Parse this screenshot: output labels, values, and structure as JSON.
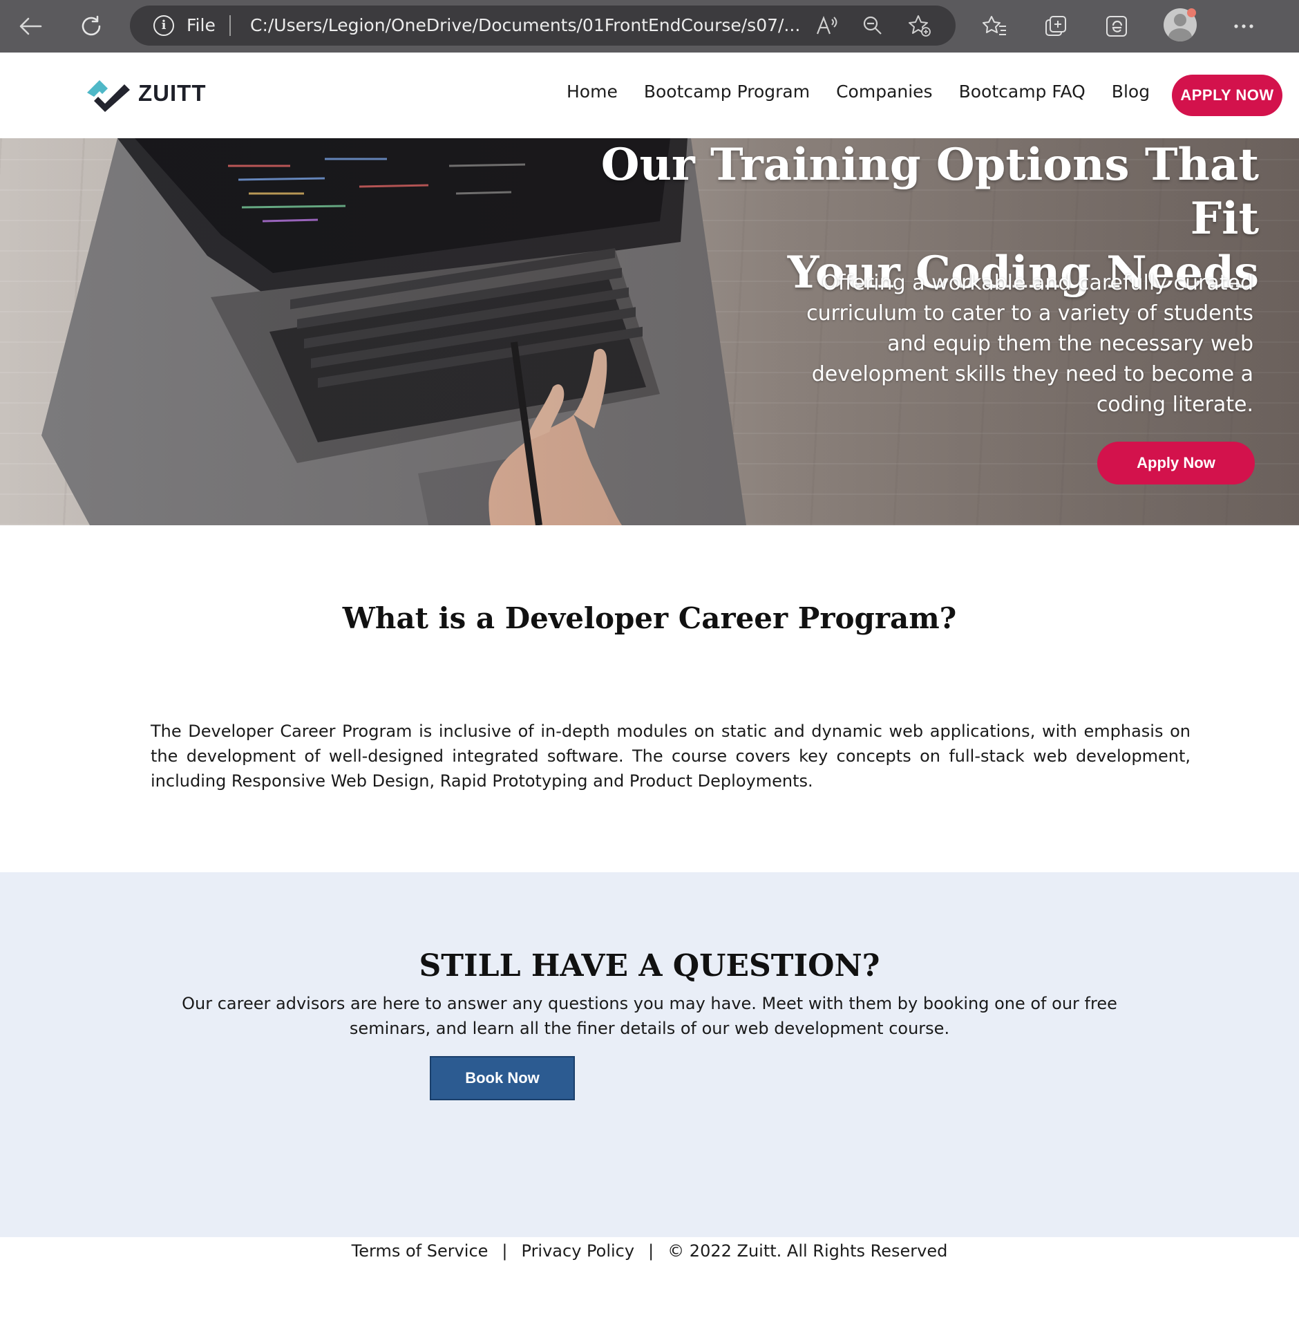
{
  "browser": {
    "file_label": "File",
    "url": "C:/Users/Legion/OneDrive/Documents/01FrontEndCourse/s07/..."
  },
  "navbar": {
    "logo_text": "ZUITT",
    "links": [
      "Home",
      "Bootcamp Program",
      "Companies",
      "Bootcamp FAQ",
      "Blog"
    ],
    "apply_label": "APPLY NOW"
  },
  "hero": {
    "title_line1": "Our Training Options That Fit",
    "title_line2": "Your Coding Needs",
    "subtitle": "Offering a workable and carefully curated curriculum to cater to a variety of students and equip them the necessary web development skills they need to become a coding literate.",
    "button_label": "Apply Now"
  },
  "program": {
    "title": "What is a Developer Career Program?",
    "description": "The Developer Career Program is inclusive of in-depth modules on static and dynamic web applications, with emphasis on the development of well-designed integrated software. The course covers key concepts on full-stack web development, including Responsive Web Design, Rapid Prototyping and Product Deployments."
  },
  "question": {
    "title": "STILL HAVE A QUESTION?",
    "text": "Our career advisors are here to answer any questions you may have. Meet with them by booking one of our free seminars, and learn all the finer details of our web development course.",
    "button_label": "Book Now"
  },
  "footer": {
    "terms": "Terms of Service",
    "separator": "|",
    "privacy": "Privacy Policy",
    "copyright": "© 2022 Zuitt. All Rights Reserved"
  },
  "colors": {
    "accent": "#d3124c",
    "book_button": "#2c5b91",
    "question_bg": "#e9eef7",
    "chrome_bg": "#5b5a5d"
  }
}
